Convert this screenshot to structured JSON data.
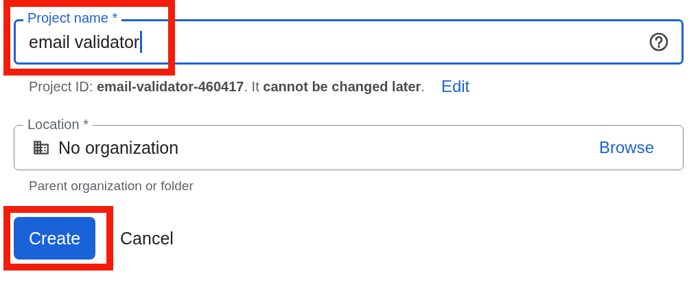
{
  "project_name": {
    "label": "Project name *",
    "value": "email validator",
    "focused": true,
    "highlighted": true
  },
  "project_id_note": "Project ID: **email-validator-460417**. It **cannot be changed later**.",
  "edit_link": "Edit",
  "location": {
    "label": "Location *",
    "value": "No organization",
    "action": "Browse",
    "focused": false
  },
  "location_hint": "Parent organization or folder",
  "buttons": [
    {
      "label": "Create",
      "kind": "primary",
      "highlighted": true
    },
    {
      "label": "Cancel",
      "kind": "text",
      "highlighted": false
    }
  ]
}
